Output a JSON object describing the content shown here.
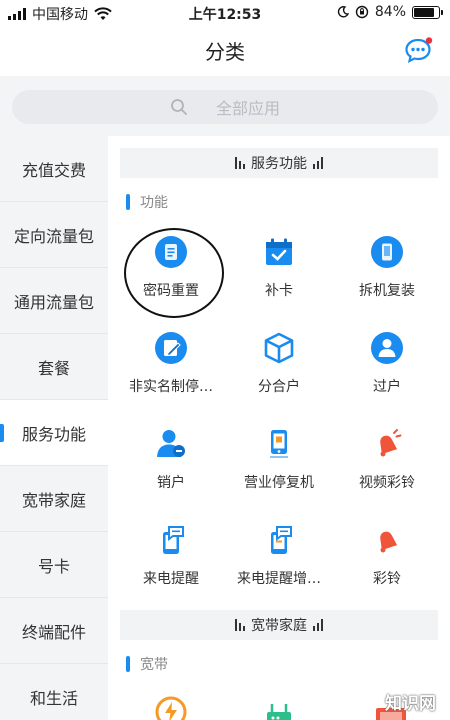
{
  "status": {
    "carrier": "中国移动",
    "time": "上午12:53",
    "battery_text": "84%",
    "battery_level": 0.84
  },
  "header": {
    "title": "分类"
  },
  "search": {
    "placeholder": "全部应用"
  },
  "sidebar": {
    "items": [
      {
        "label": "充值交费"
      },
      {
        "label": "定向流量包"
      },
      {
        "label": "通用流量包"
      },
      {
        "label": "套餐"
      },
      {
        "label": "服务功能",
        "active": true
      },
      {
        "label": "宽带家庭"
      },
      {
        "label": "号卡"
      },
      {
        "label": "终端配件"
      },
      {
        "label": "和生活"
      }
    ]
  },
  "content": {
    "section1": {
      "title": "服务功能",
      "group": "功能"
    },
    "items": [
      {
        "label": "密码重置",
        "icon": "key-icon"
      },
      {
        "label": "补卡",
        "icon": "calendar-check-icon"
      },
      {
        "label": "拆机复装",
        "icon": "phone-icon"
      },
      {
        "label": "非实名制停…",
        "icon": "edit-icon"
      },
      {
        "label": "分合户",
        "icon": "cube-icon"
      },
      {
        "label": "过户",
        "icon": "user-transfer-icon"
      },
      {
        "label": "销户",
        "icon": "user-cancel-icon"
      },
      {
        "label": "营业停复机",
        "icon": "mobile-icon"
      },
      {
        "label": "视频彩铃",
        "icon": "bell-icon"
      },
      {
        "label": "来电提醒",
        "icon": "call-reminder-icon"
      },
      {
        "label": "来电提醒增…",
        "icon": "call-reminder-plus-icon"
      },
      {
        "label": "彩铃",
        "icon": "ring-icon"
      }
    ],
    "section2": {
      "title": "宽带家庭",
      "group": "宽带"
    }
  },
  "watermark": " 知识网",
  "colors": {
    "accent": "#1a8cf0",
    "orange": "#f59a23",
    "red": "#f0553a",
    "panel": "#f3f4f6"
  }
}
